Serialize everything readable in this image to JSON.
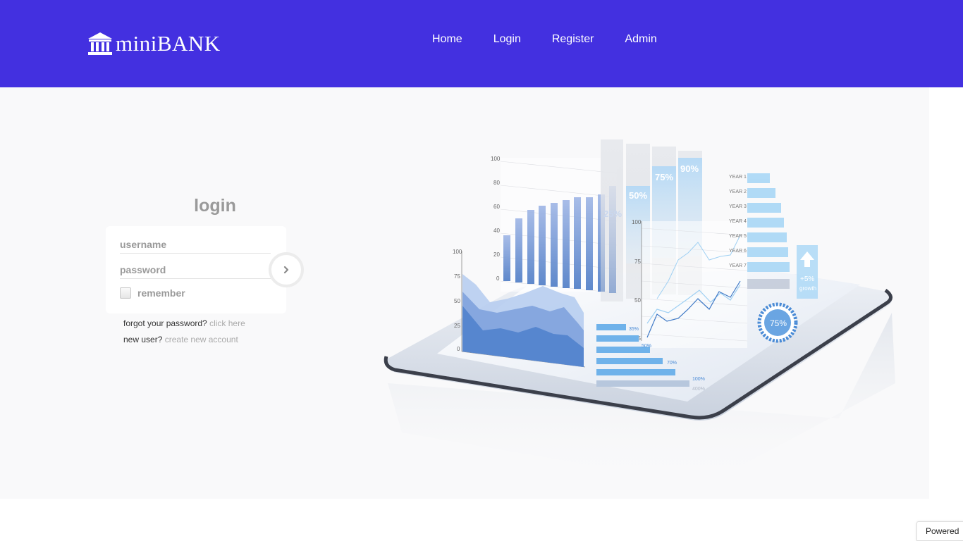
{
  "brand": {
    "name": "miniBANK",
    "icon": "bank-icon"
  },
  "nav": {
    "items": [
      "Home",
      "Login",
      "Register",
      "Admin"
    ]
  },
  "login": {
    "title": "login",
    "username_placeholder": "username",
    "password_placeholder": "password",
    "remember_label": "remember",
    "forgot_text": "forgot your password?",
    "forgot_link": "click here",
    "new_user_text": "new user?",
    "new_user_link": "create new account",
    "submit_icon": "chevron-right-icon"
  },
  "illustration": {
    "bar_axis": [
      "100",
      "80",
      "60",
      "40",
      "20",
      "0"
    ],
    "area_axis": [
      "100",
      "75",
      "50",
      "25",
      "0"
    ],
    "line_axis": [
      "100",
      "75",
      "50",
      "25"
    ],
    "percent_bars": [
      "50%",
      "75%",
      "90%"
    ],
    "percent_under": "25%",
    "years": [
      "YEAR 1",
      "YEAR 2",
      "YEAR 3",
      "YEAR 4",
      "YEAR 5",
      "YEAR 6",
      "YEAR 7"
    ],
    "tiny_bars": [
      "35%",
      "50%",
      "70%",
      "100%",
      "400%"
    ],
    "growth_value": "+5%",
    "growth_label": "growth",
    "gauge_value": "75%"
  },
  "footer": {
    "powered": "Powered"
  },
  "colors": {
    "navbar": "#4330e0",
    "hero_bg": "#f9f9fa",
    "accent_blue": "#5b8fd6"
  }
}
